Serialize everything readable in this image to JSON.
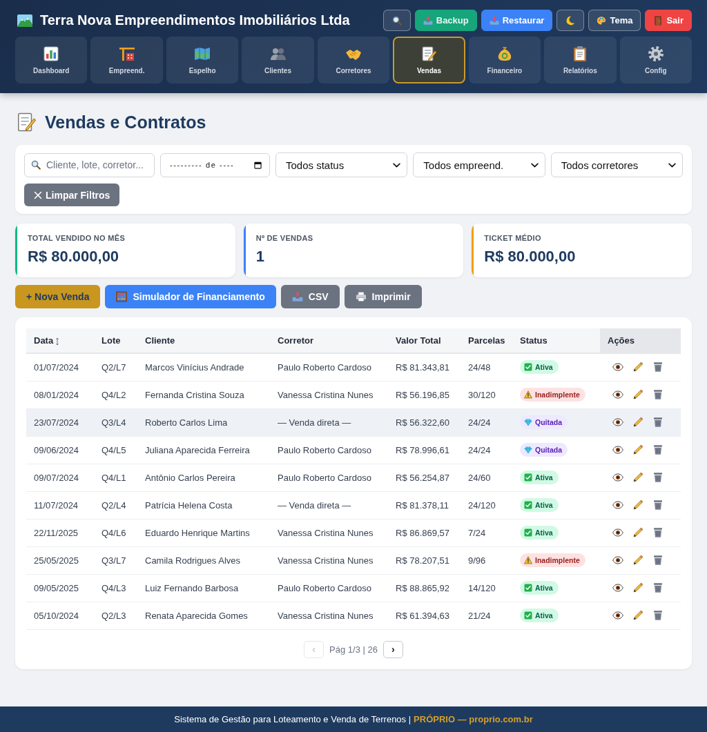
{
  "header": {
    "title": "Terra Nova Empreendimentos Imobiliários Ltda",
    "buttons": [
      {
        "kind": "search"
      },
      {
        "kind": "backup",
        "label": "Backup"
      },
      {
        "kind": "restore",
        "label": "Restaurar"
      },
      {
        "kind": "dark_mode"
      },
      {
        "kind": "theme",
        "label": "Tema"
      },
      {
        "kind": "exit",
        "label": "Sair"
      }
    ]
  },
  "nav": [
    {
      "kind": "dashboard",
      "label": "Dashboard",
      "selected": false
    },
    {
      "kind": "developments",
      "label": "Empreend.",
      "selected": false
    },
    {
      "kind": "site_map",
      "label": "Espelho",
      "selected": false
    },
    {
      "kind": "clients",
      "label": "Clientes",
      "selected": false
    },
    {
      "kind": "brokers",
      "label": "Corretores",
      "selected": false
    },
    {
      "kind": "sales",
      "label": "Vendas",
      "selected": true
    },
    {
      "kind": "finance",
      "label": "Financeiro",
      "selected": false
    },
    {
      "kind": "reports",
      "label": "Relatórios",
      "selected": false
    },
    {
      "kind": "settings",
      "label": "Config",
      "selected": false
    }
  ],
  "page_title": "Vendas e Contratos",
  "filters": {
    "search": {
      "placeholder": "Cliente, lote, corretor..."
    },
    "month": {
      "placeholder": "--------- de ----"
    },
    "selects": [
      {
        "value": "Todos status"
      },
      {
        "value": "Todos empreend."
      },
      {
        "value": "Todos corretores"
      }
    ],
    "clear_button": "Limpar Filtros"
  },
  "stats": [
    {
      "label": "TOTAL VENDIDO NO MÊS",
      "value": "R$ 80.000,00",
      "color": "#10b981"
    },
    {
      "label": "Nº DE VENDAS",
      "value": "1",
      "color": "#3b82f6"
    },
    {
      "label": "TICKET MÉDIO",
      "value": "R$ 80.000,00",
      "color": "#f59e0b"
    }
  ],
  "actions": [
    {
      "kind": "new",
      "label": "+ Nova Venda"
    },
    {
      "kind": "simulator",
      "label": "Simulador de Financiamento"
    },
    {
      "kind": "csv",
      "label": "CSV"
    },
    {
      "kind": "print",
      "label": "Imprimir"
    }
  ],
  "table": {
    "columns": [
      {
        "label": "Data",
        "sorted": true
      },
      {
        "label": "Lote",
        "sorted": false
      },
      {
        "label": "Cliente",
        "sorted": false
      },
      {
        "label": "Corretor",
        "sorted": false
      },
      {
        "label": "Valor Total",
        "sorted": false
      },
      {
        "label": "Parcelas",
        "sorted": false
      },
      {
        "label": "Status",
        "sorted": false
      },
      {
        "label": "Ações",
        "sorted": false
      }
    ],
    "rows": [
      {
        "date": "01/07/2024",
        "lot": "Q2/L7",
        "client": "Marcos Vinícius Andrade",
        "broker": "Paulo Roberto Cardoso",
        "total": "R$ 81.343,81",
        "installments": "24/48",
        "status": {
          "kind": "active",
          "label": "Ativa"
        },
        "highlighted": false
      },
      {
        "date": "08/01/2024",
        "lot": "Q4/L2",
        "client": "Fernanda Cristina Souza",
        "broker": "Vanessa Cristina Nunes",
        "total": "R$ 56.196,85",
        "installments": "30/120",
        "status": {
          "kind": "overdue",
          "label": "Inadimplente"
        },
        "highlighted": false
      },
      {
        "date": "23/07/2024",
        "lot": "Q3/L4",
        "client": "Roberto Carlos Lima",
        "broker": "— Venda direta —",
        "total": "R$ 56.322,60",
        "installments": "24/24",
        "status": {
          "kind": "paid",
          "label": "Quitada"
        },
        "highlighted": true
      },
      {
        "date": "09/06/2024",
        "lot": "Q4/L5",
        "client": "Juliana Aparecida Ferreira",
        "broker": "Paulo Roberto Cardoso",
        "total": "R$ 78.996,61",
        "installments": "24/24",
        "status": {
          "kind": "paid",
          "label": "Quitada"
        },
        "highlighted": false
      },
      {
        "date": "09/07/2024",
        "lot": "Q4/L1",
        "client": "Antônio Carlos Pereira",
        "broker": "Paulo Roberto Cardoso",
        "total": "R$ 56.254,87",
        "installments": "24/60",
        "status": {
          "kind": "active",
          "label": "Ativa"
        },
        "highlighted": false
      },
      {
        "date": "11/07/2024",
        "lot": "Q2/L4",
        "client": "Patrícia Helena Costa",
        "broker": "— Venda direta —",
        "total": "R$ 81.378,11",
        "installments": "24/120",
        "status": {
          "kind": "active",
          "label": "Ativa"
        },
        "highlighted": false
      },
      {
        "date": "22/11/2025",
        "lot": "Q4/L6",
        "client": "Eduardo Henrique Martins",
        "broker": "Vanessa Cristina Nunes",
        "total": "R$ 86.869,57",
        "installments": "7/24",
        "status": {
          "kind": "active",
          "label": "Ativa"
        },
        "highlighted": false
      },
      {
        "date": "25/05/2025",
        "lot": "Q3/L7",
        "client": "Camila Rodrigues Alves",
        "broker": "Vanessa Cristina Nunes",
        "total": "R$ 78.207,51",
        "installments": "9/96",
        "status": {
          "kind": "overdue",
          "label": "Inadimplente"
        },
        "highlighted": false
      },
      {
        "date": "09/05/2025",
        "lot": "Q4/L3",
        "client": "Luiz Fernando Barbosa",
        "broker": "Paulo Roberto Cardoso",
        "total": "R$ 88.865,92",
        "installments": "14/120",
        "status": {
          "kind": "active",
          "label": "Ativa"
        },
        "highlighted": false
      },
      {
        "date": "05/10/2024",
        "lot": "Q2/L3",
        "client": "Renata Aparecida Gomes",
        "broker": "Vanessa Cristina Nunes",
        "total": "R$ 61.394,63",
        "installments": "21/24",
        "status": {
          "kind": "active",
          "label": "Ativa"
        },
        "highlighted": false
      }
    ]
  },
  "pagination": {
    "prev": {
      "label": "‹",
      "disabled": true
    },
    "info": "Pág 1/3 | 26",
    "next": {
      "label": "›",
      "disabled": false
    }
  },
  "footer": {
    "text": "Sistema de Gestão para Loteamento e Venda de Terrenos |",
    "link": "PRÓPRIO — proprio.com.br"
  }
}
